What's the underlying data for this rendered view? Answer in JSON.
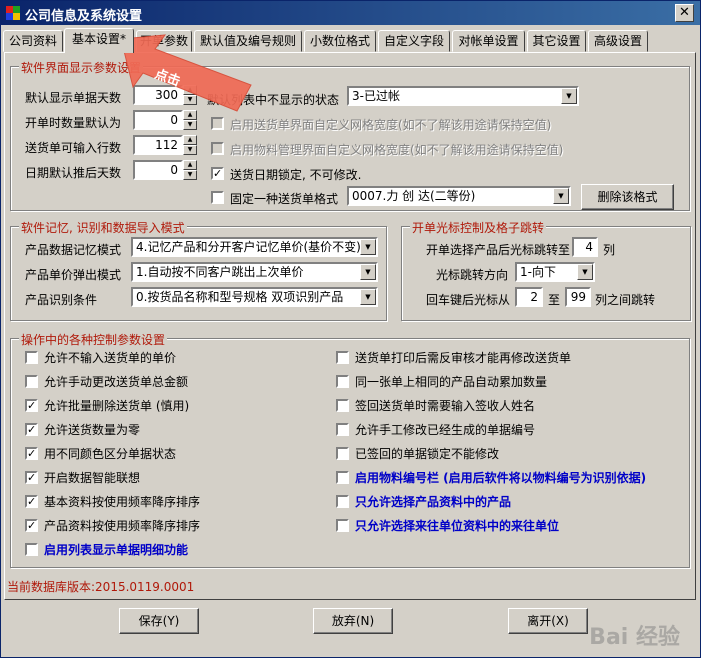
{
  "window": {
    "title": "公司信息及系统设置",
    "close": "✕"
  },
  "tabs": [
    "公司资料",
    "基本设置*",
    "开单参数",
    "默认值及编号规则",
    "小数位格式",
    "自定义字段",
    "对帐单设置",
    "其它设置",
    "高级设置"
  ],
  "active_tab": "基本设置*",
  "annotation": "点击",
  "group_display": {
    "title": "软件界面显示参数设置",
    "days_label": "默认显示单据天数",
    "days_value": "300",
    "qty_label": "开单时数量默认为",
    "qty_value": "0",
    "rows_label": "送货单可输入行数",
    "rows_value": "112",
    "delay_label": "日期默认推后天数",
    "delay_value": "0",
    "hidden_status_label": "默认列表中不显示的状态",
    "hidden_status_value": "3-已过帐",
    "opt_custom_grid": "启用送货单界面自定义网格宽度(如不了解该用途请保持空值)",
    "opt_material_grid": "启用物料管理界面自定义网格宽度(如不了解该用途请保持空值)",
    "opt_date_lock": "送货日期锁定, 不可修改.",
    "opt_fixed_format": "固定一种送货单格式",
    "format_value": "0007.力 创 达(二等份)",
    "delete_format": "删除该格式"
  },
  "group_memory": {
    "title": "软件记忆, 识别和数据导入模式",
    "mem_label": "产品数据记忆模式",
    "mem_value": "4.记忆产品和分开客户记忆单价(基价不变)",
    "price_label": "产品单价弹出模式",
    "price_value": "1.自动按不同客户跳出上次单价",
    "ident_label": "产品识别条件",
    "ident_value": "0.按货品名称和型号规格 双项识别产品"
  },
  "group_cursor": {
    "title": "开单光标控制及格子跳转",
    "jump_label": "开单选择产品后光标跳转至",
    "jump_value": "4",
    "jump_unit": "列",
    "dir_label": "光标跳转方向",
    "dir_value": "1-向下",
    "enter_label": "回车键后光标从",
    "enter_from": "2",
    "enter_to_label": "至",
    "enter_to": "99",
    "enter_tail": "列之间跳转"
  },
  "group_ops": {
    "title": "操作中的各种控制参数设置",
    "left": [
      {
        "label": "允许不输入送货单的单价",
        "checked": false,
        "blue": false
      },
      {
        "label": "允许手动更改送货单总金额",
        "checked": false,
        "blue": false
      },
      {
        "label": "允许批量删除送货单 (慎用)",
        "checked": true,
        "blue": false
      },
      {
        "label": "允许送货数量为零",
        "checked": true,
        "blue": false
      },
      {
        "label": "用不同颜色区分单据状态",
        "checked": true,
        "blue": false
      },
      {
        "label": "开启数据智能联想",
        "checked": true,
        "blue": false
      },
      {
        "label": "基本资料按使用频率降序排序",
        "checked": true,
        "blue": false
      },
      {
        "label": "产品资料按使用频率降序排序",
        "checked": true,
        "blue": false
      },
      {
        "label": "启用列表显示单据明细功能",
        "checked": false,
        "blue": true
      }
    ],
    "right": [
      {
        "label": "送货单打印后需反审核才能再修改送货单",
        "checked": false,
        "blue": false
      },
      {
        "label": "同一张单上相同的产品自动累加数量",
        "checked": false,
        "blue": false
      },
      {
        "label": "签回送货单时需要输入签收人姓名",
        "checked": false,
        "blue": false
      },
      {
        "label": "允许手工修改已经生成的单据编号",
        "checked": false,
        "blue": false
      },
      {
        "label": "已签回的单据锁定不能修改",
        "checked": false,
        "blue": false
      },
      {
        "label": "启用物料编号栏 (启用后软件将以物料编号为识别依据)",
        "checked": false,
        "blue": true
      },
      {
        "label": "只允许选择产品资料中的产品",
        "checked": false,
        "blue": true
      },
      {
        "label": "只允许选择来往单位资料中的来往单位",
        "checked": false,
        "blue": true
      }
    ]
  },
  "status": "当前数据库版本:2015.0119.0001",
  "buttons": {
    "save": "保存(Y)",
    "cancel": "放弃(N)",
    "exit": "离开(X)"
  },
  "watermark": "Bai 经验"
}
